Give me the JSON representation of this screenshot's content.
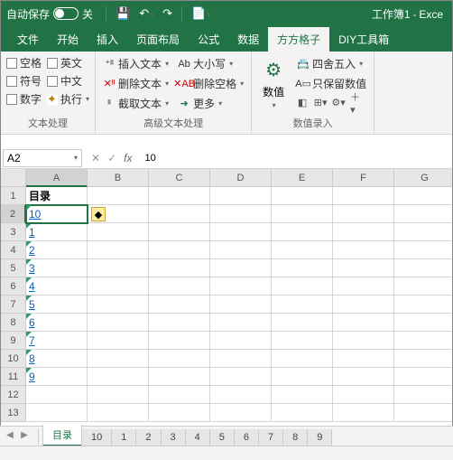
{
  "titlebar": {
    "autosave": "自动保存",
    "autosave_state": "关",
    "doc": "工作簿1",
    "app": "Exce"
  },
  "tabs": [
    "文件",
    "开始",
    "插入",
    "页面布局",
    "公式",
    "数据",
    "方方格子",
    "DIY工具箱"
  ],
  "tab_active": 6,
  "ribbon": {
    "g1": {
      "items": [
        "空格",
        "英文",
        "符号",
        "中文",
        "数字",
        "执行"
      ],
      "label": "文本处理"
    },
    "g2": {
      "items": [
        "插入文本",
        "删除文本",
        "截取文本",
        "大小写",
        "删除空格",
        "更多"
      ],
      "label": "高级文本处理"
    },
    "g3": {
      "big": "数值",
      "items": [
        "四舍五入",
        "只保留数值"
      ],
      "label": "数值录入"
    }
  },
  "namebox": "A2",
  "fbval": "10",
  "cols": [
    "A",
    "B",
    "C",
    "D",
    "E",
    "F",
    "G"
  ],
  "rows": [
    1,
    2,
    3,
    4,
    5,
    6,
    7,
    8,
    9,
    10,
    11,
    12,
    13
  ],
  "cells": {
    "A1": "目录",
    "A2": "10",
    "A3": "1",
    "A4": "2",
    "A5": "3",
    "A6": "4",
    "A7": "5",
    "A8": "6",
    "A9": "7",
    "A10": "8",
    "A11": "9"
  },
  "active": "A2",
  "sheets": [
    "目录",
    "10",
    "1",
    "2",
    "3",
    "4",
    "5",
    "6",
    "7",
    "8",
    "9"
  ],
  "sheet_active": 0
}
